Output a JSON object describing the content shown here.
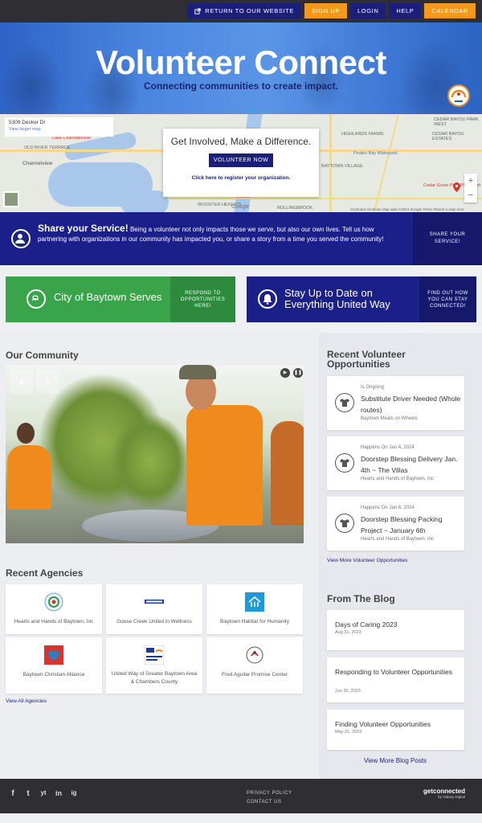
{
  "topbar": {
    "return_label": "RETURN TO OUR WEBSITE",
    "signup_label": "SIGN UP",
    "login_label": "LOGIN",
    "help_label": "HELP",
    "calendar_label": "CALENDAR"
  },
  "hero": {
    "title": "Volunteer Connect",
    "subtitle": "Connecting communities to create impact."
  },
  "map": {
    "address": "5309 Decker Dr",
    "view_larger": "View larger map",
    "labels": [
      "Channelview",
      "OLD RIVER TERRACE",
      "HIGHLANDS FARMS",
      "Pirates Bay Waterpark",
      "BAYTOWN VILLAGE",
      "CEDAR BAYOU PARK WEST",
      "CEDAR BAYOU ESTATES",
      "Cedar Grove Park RV Resort",
      "WOOSTER HEIGHTS",
      "ROLLINGBROOK",
      "Lake Charlottesville"
    ],
    "card_heading": "Get Involved, Make a Difference.",
    "volunteer_now": "VOLUNTEER NOW",
    "register_org": "Click here to register your organization.",
    "google": "Google",
    "footer_text": "Keyboard shortcuts   Map data ©2024 Google   Terms   Report a map error"
  },
  "share": {
    "title": "Share your Service!",
    "body": "Being a volunteer not only impacts those we serve, but also our own lives. Tell us how partnering with organizations in our community has impacted you, or share a story from a time you served the community!",
    "side": "SHARE YOUR SERVICE!"
  },
  "promos": {
    "baytown_title": "City of Baytown Serves",
    "baytown_side": "RESPOND TO OPPORTUNITIES HERE!",
    "united_title": "Stay Up to Date on Everything United Way",
    "united_side": "FIND OUT HOW YOU CAN STAY CONNECTED!"
  },
  "community": {
    "heading": "Our Community"
  },
  "agencies": {
    "heading": "Recent Agencies",
    "items": [
      {
        "name": "Hearts and Hands of Baytown, Inc"
      },
      {
        "name": "Goose Creek United in Wellness"
      },
      {
        "name": "Baytown Habitat for Humanity"
      },
      {
        "name": "Baytown Christian Alliance"
      },
      {
        "name": "United Way of Greater Baytown Area & Chambers County"
      },
      {
        "name": "Fred Aguilar Promise Center"
      }
    ],
    "view_all": "View All Agencies"
  },
  "opportunities": {
    "heading": "Recent Volunteer Opportunities",
    "items": [
      {
        "meta": "Is Ongoing",
        "title": "Substitute Driver Needed (Whole routes)",
        "org": "Baytown Meals on Wheels"
      },
      {
        "meta": "Happens On Jan 4, 2024",
        "title": "Doorstep Blessing Delivery Jan. 4th ~ The Villas",
        "org": "Hearts and Hands of Baytown, Inc"
      },
      {
        "meta": "Happens On Jan 6, 2024",
        "title": "Doorstep Blessing Packing Project ~ January 6th",
        "org": "Hearts and Hands of Baytown, Inc"
      }
    ],
    "view_more": "View More Volunteer Opportunities"
  },
  "blog": {
    "heading": "From The Blog",
    "items": [
      {
        "title": "Days of Caring 2023",
        "date": "Aug 31, 2023"
      },
      {
        "title": "Responding to Volunteer Opportunities",
        "date": "Jun 30, 2023"
      },
      {
        "title": "Finding Volunteer Opportunities",
        "date": "May 31, 2023"
      }
    ],
    "view_more": "View More Blog Posts"
  },
  "footer": {
    "privacy": "PRIVACY POLICY",
    "contact": "CONTACT US",
    "brand": "getconnected",
    "brand_sub": "by Galaxy Digital",
    "social": [
      "f",
      "t",
      "yt",
      "in",
      "ig"
    ]
  },
  "colors": {
    "navy": "#1b1f7a",
    "orange": "#f39a1e",
    "green": "#39a44a",
    "topbar": "#2f2f33"
  }
}
